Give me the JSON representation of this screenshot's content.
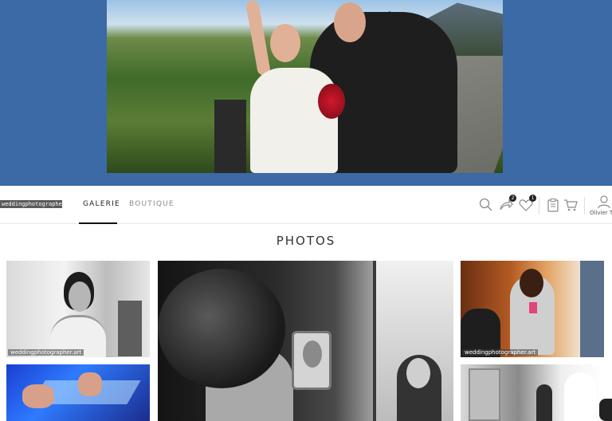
{
  "header": {
    "logo_text": "weddingphotographer.art",
    "tabs": [
      {
        "label": "GALERIE",
        "active": true
      },
      {
        "label": "BOUTIQUE",
        "active": false
      }
    ],
    "icons": [
      {
        "name": "search-icon"
      },
      {
        "name": "share-icon",
        "badge": "2"
      },
      {
        "name": "heart-icon",
        "badge": "1"
      },
      {
        "name": "clipboard-icon"
      },
      {
        "name": "cart-icon"
      },
      {
        "name": "user-icon"
      }
    ],
    "user_name": "Olivier T"
  },
  "main": {
    "section_title": "PHOTOS",
    "watermark": "weddingphotographer.art"
  },
  "colors": {
    "hero_background": "#3b6aa6",
    "active_tab": "#222222",
    "inactive_tab": "#8c8c8c"
  }
}
